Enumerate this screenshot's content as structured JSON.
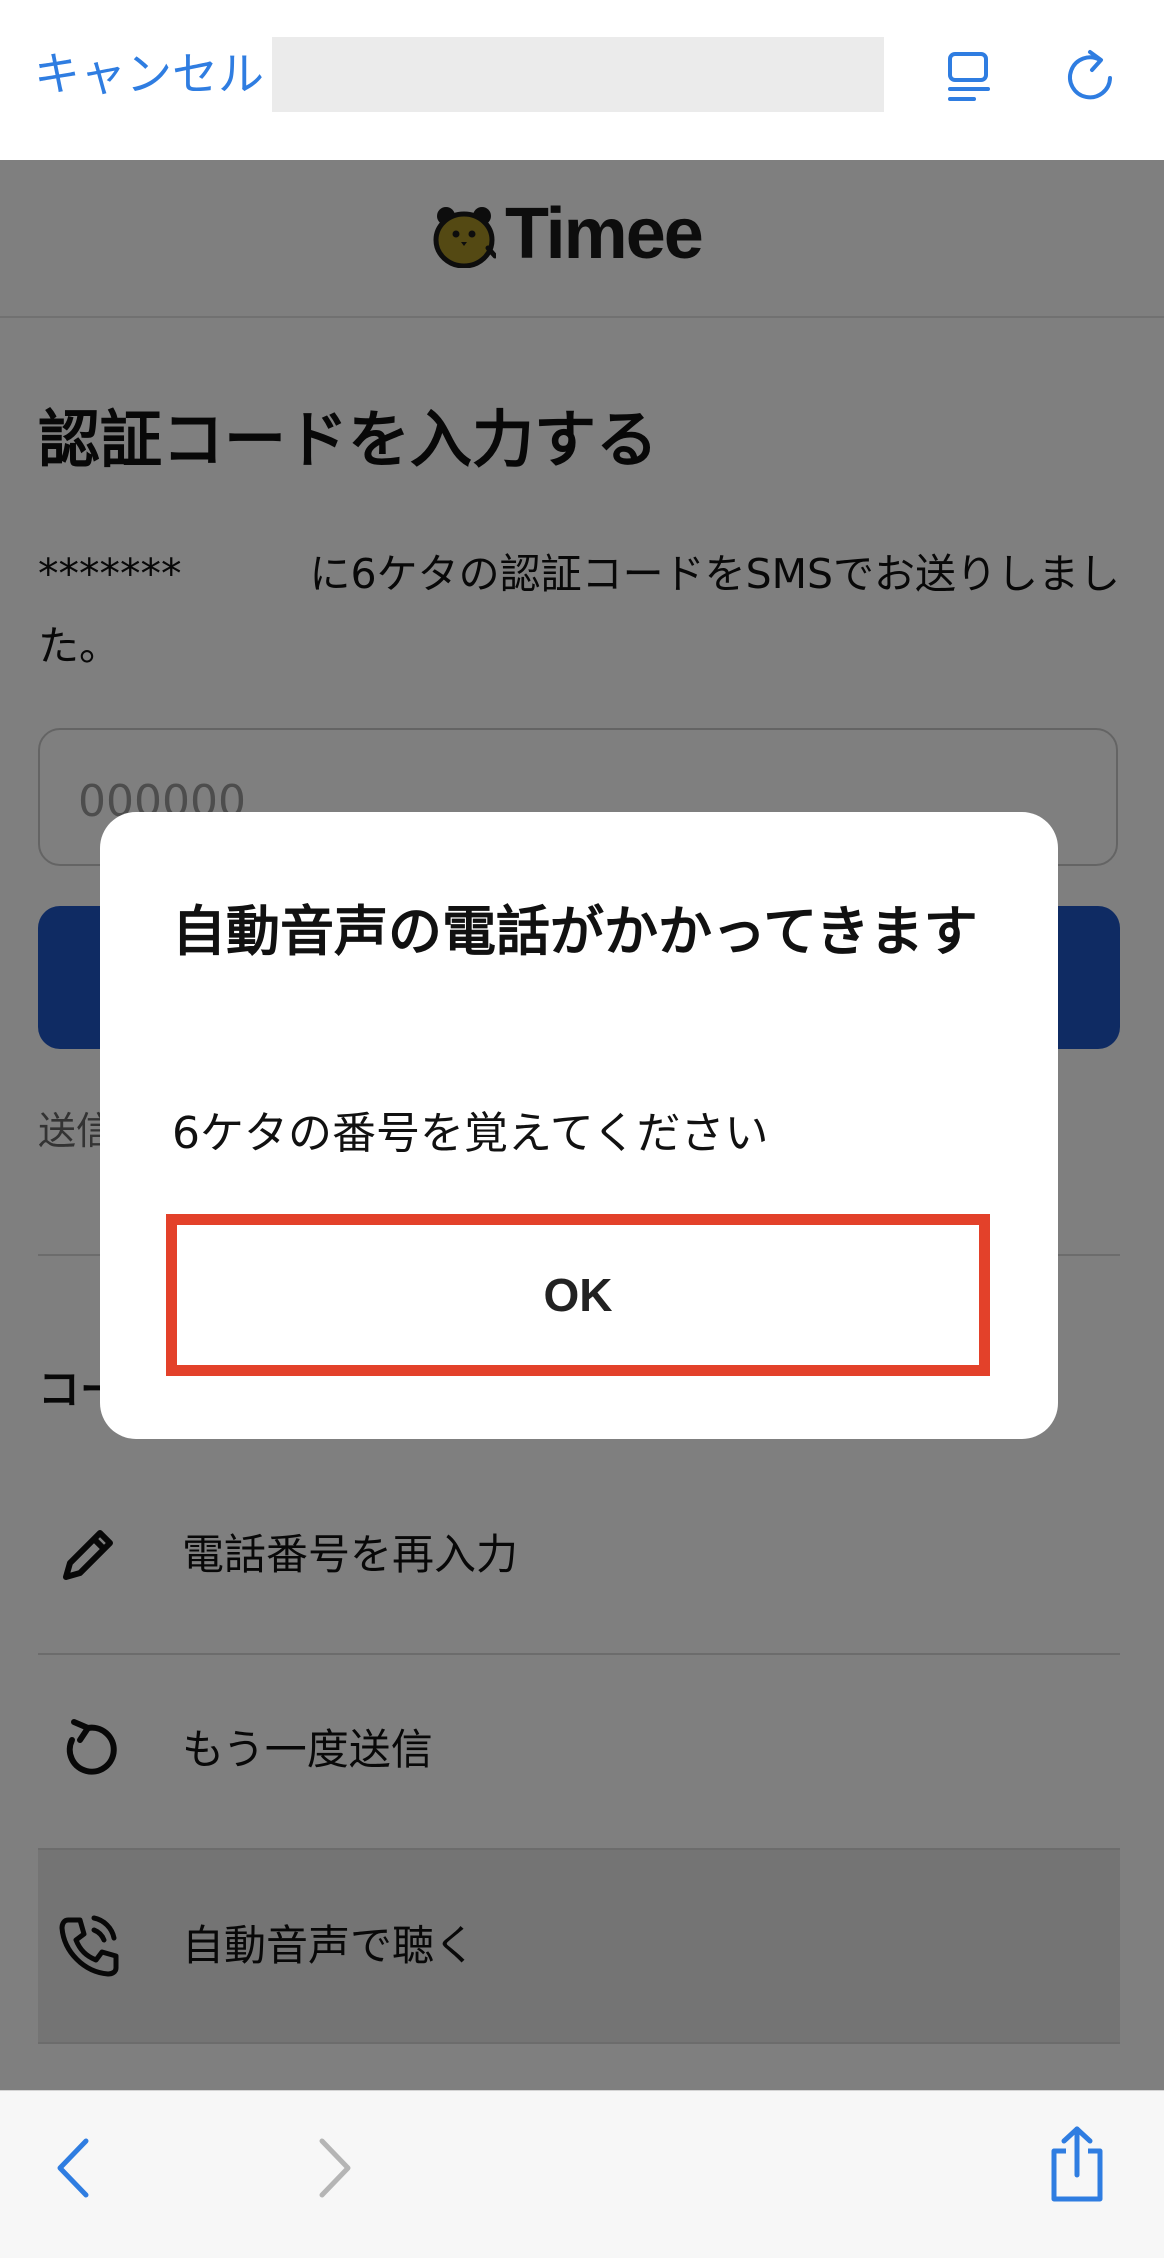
{
  "browser": {
    "cancel_label": "キャンセル",
    "icons": [
      "reader-icon",
      "reload-icon"
    ]
  },
  "header": {
    "brand": "Timee"
  },
  "main": {
    "title": "認証コードを入力する",
    "description_prefix": "*******",
    "description_suffix": "に6ケタの認証コードをSMSでお送りしました。",
    "code_placeholder": "000000",
    "send_note": "送信",
    "section_title": "コー",
    "options": [
      {
        "label": "電話番号を再入力",
        "icon": "pencil-icon"
      },
      {
        "label": "もう一度送信",
        "icon": "refresh-icon"
      },
      {
        "label": "自動音声で聴く",
        "icon": "phone-call-icon"
      }
    ]
  },
  "modal": {
    "title": "自動音声の電話がかかってきます",
    "message": "6ケタの番号を覚えてください",
    "ok_label": "OK"
  },
  "colors": {
    "accent": "#2f7de1",
    "primary_button": "#1f57c6",
    "highlight_border": "#e3412a"
  }
}
